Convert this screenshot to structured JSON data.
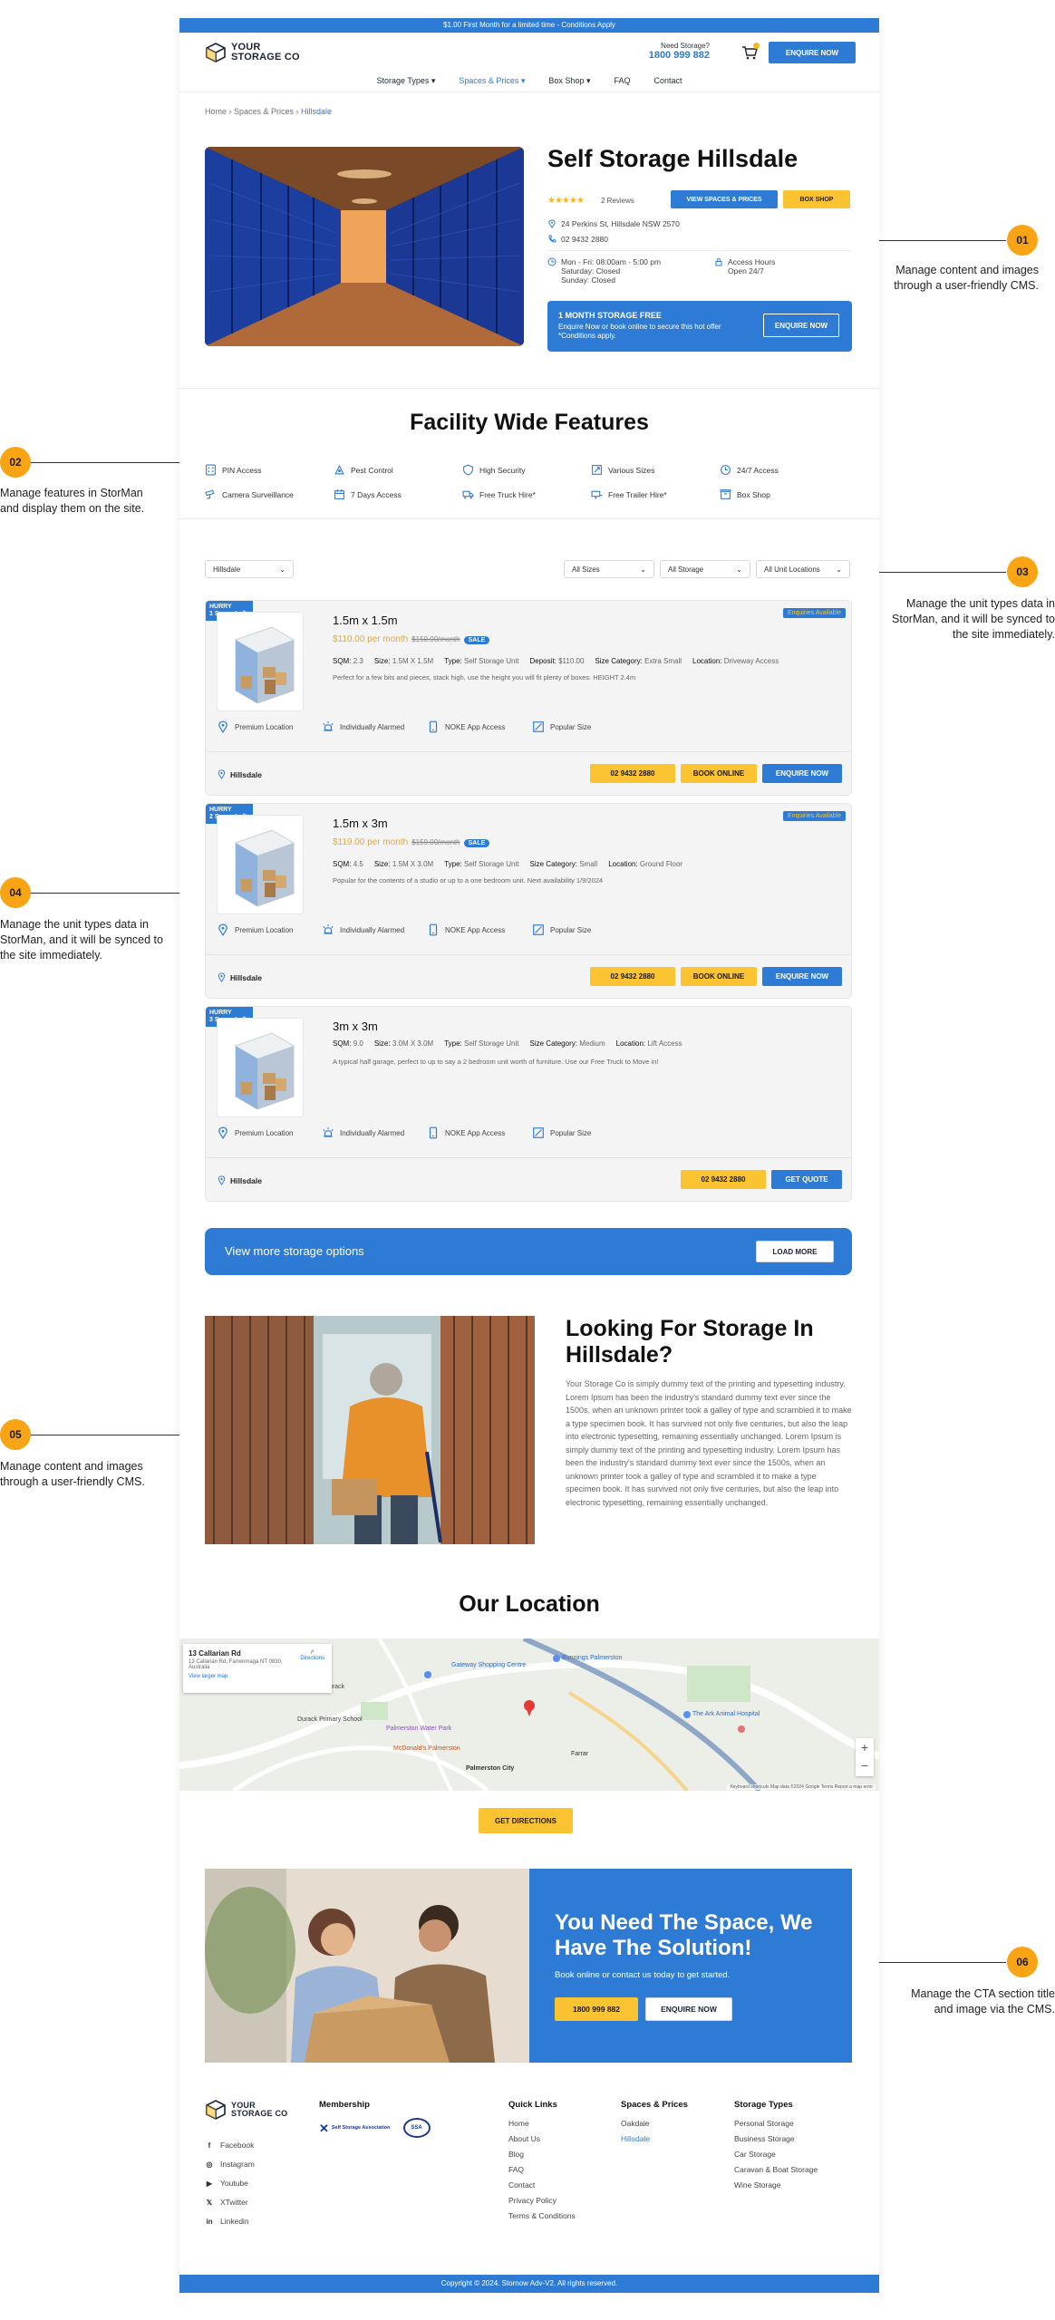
{
  "promo_bar": "$1.00 First Month for a limited time - Conditions Apply",
  "header": {
    "logo_line1": "YOUR",
    "logo_line2": "STORAGE CO",
    "need_storage": "Need Storage?",
    "phone": "1800 999 882",
    "enquire": "ENQUIRE NOW"
  },
  "nav": [
    "Storage Types",
    "Spaces & Prices",
    "Box Shop",
    "FAQ",
    "Contact"
  ],
  "breadcrumb": {
    "home": "Home",
    "spaces": "Spaces & Prices",
    "current": "Hillsdale"
  },
  "hero": {
    "title": "Self Storage Hillsdale",
    "reviews": "2 Reviews",
    "rating_stars": 5,
    "view_btn": "VIEW SPACES & PRICES",
    "box_btn": "BOX SHOP",
    "address": "24 Perkins St, Hillsdale NSW 2570",
    "phone": "02 9432 2880",
    "hours_line1": "Mon - Fri: 08:00am - 5:00 pm",
    "hours_line2": "Saturday: Closed",
    "hours_line3": "Sunday: Closed",
    "access_title": "Access Hours",
    "access_value": "Open 24/7",
    "offer_title": "1 MONTH STORAGE FREE",
    "offer_text": "Enquire Now or book online to secure this hot offer",
    "offer_note": "*Conditions apply.",
    "offer_btn": "ENQUIRE NOW"
  },
  "features": {
    "title": "Facility Wide Features",
    "items": [
      {
        "label": "PIN Access",
        "icon": "pin-pad-icon"
      },
      {
        "label": "Pest Control",
        "icon": "pest-control-icon"
      },
      {
        "label": "High Security",
        "icon": "shield-icon"
      },
      {
        "label": "Various Sizes",
        "icon": "sizes-icon"
      },
      {
        "label": "24/7 Access",
        "icon": "clock-icon"
      },
      {
        "label": "Camera Surveillance",
        "icon": "camera-icon"
      },
      {
        "label": "7 Days Access",
        "icon": "calendar-icon"
      },
      {
        "label": "Free Truck Hire*",
        "icon": "truck-icon"
      },
      {
        "label": "Free Trailer Hire*",
        "icon": "trailer-icon"
      },
      {
        "label": "Box Shop",
        "icon": "box-icon"
      }
    ]
  },
  "filters": {
    "location": "Hillsdale",
    "sizes": "All Sizes",
    "storage": "All Storage",
    "unit_locations": "All Unit Locations"
  },
  "units": [
    {
      "hurry_line1": "HURRY",
      "hurry_line2": "1 Space Left",
      "title": "1.5m x 1.5m",
      "price": "$110.00 per month",
      "old_price": "$150.00/month",
      "sale": "SALE",
      "enquiries": "Enquiries Available",
      "specs": [
        [
          "SQM:",
          "2.3"
        ],
        [
          "Size:",
          "1.5M X 1.5M"
        ],
        [
          "Type:",
          "Self Storage Unit"
        ],
        [
          "Deposit:",
          "$110.00"
        ],
        [
          "Size Category:",
          "Extra Small"
        ],
        [
          "Location:",
          "Driveway Access"
        ]
      ],
      "desc": "Perfect for a few bits and pieces, stack high, use the height you will fit plenty of boxes. HEIGHT 2.4m",
      "amenities": [
        "Premium Location",
        "Individually Alarmed",
        "NOKE App Access",
        "Popular Size"
      ],
      "location": "Hillsdale",
      "phone_btn": "02 9432 2880",
      "book_btn": "BOOK ONLINE",
      "enquire_btn": "ENQUIRE NOW"
    },
    {
      "hurry_line1": "HURRY",
      "hurry_line2": "2 Space Left",
      "title": "1.5m x 3m",
      "price": "$119.00 per month",
      "old_price": "$159.00/month",
      "sale": "SALE",
      "enquiries": "Enquiries Available",
      "specs": [
        [
          "SQM:",
          "4.5"
        ],
        [
          "Size:",
          "1.5M X 3.0M"
        ],
        [
          "Type:",
          "Self Storage Unit"
        ],
        [
          "Size Category:",
          "Small"
        ],
        [
          "Location:",
          "Ground Floor"
        ]
      ],
      "desc": "Popular for the contents of a studio or up to a one bedroom unit. Next availability 1/9/2024",
      "amenities": [
        "Premium Location",
        "Individually Alarmed",
        "NOKE App Access",
        "Popular Size"
      ],
      "location": "Hillsdale",
      "phone_btn": "02 9432 2880",
      "book_btn": "BOOK ONLINE",
      "enquire_btn": "ENQUIRE NOW"
    },
    {
      "hurry_line1": "HURRY",
      "hurry_line2": "3 Space Left",
      "title": "3m x 3m",
      "specs": [
        [
          "SQM:",
          "9.0"
        ],
        [
          "Size:",
          "3.0M X 3.0M"
        ],
        [
          "Type:",
          "Self Storage Unit"
        ],
        [
          "Size Category:",
          "Medium"
        ],
        [
          "Location:",
          "Lift Access"
        ]
      ],
      "desc": "A typical half garage, perfect to up to say a 2 bedroom unit worth of furniture. Use our Free Truck to Move in!",
      "amenities": [
        "Premium Location",
        "Individually Alarmed",
        "NOKE App Access",
        "Popular Size"
      ],
      "location": "Hillsdale",
      "phone_btn": "02 9432 2880",
      "quote_btn": "GET QUOTE"
    }
  ],
  "load_more": {
    "text": "View more storage options",
    "btn": "LOAD MORE"
  },
  "looking": {
    "title": "Looking For Storage In Hillsdale?",
    "body": "Your Storage Co is simply dummy text of the printing and typesetting industry. Lorem Ipsum has been the industry's standard dummy text ever since the 1500s, when an unknown printer took a galley of type and scrambled it to make a type specimen book. It has survived not only five centuries, but also the leap into electronic typesetting, remaining essentially unchanged. Lorem Ipsum is simply dummy text of the printing and typesetting industry. Lorem Ipsum has been the industry's standard dummy text ever since the 1500s, when an unknown printer took a galley of type and scrambled it to make a type specimen book. It has survived not only five centuries, but also the leap into electronic typesetting, remaining essentially unchanged."
  },
  "location": {
    "title": "Our Location",
    "card_title": "13 Callarian Rd",
    "card_address": "13 Callarian Rd, Farrenmaga NT 0830, Australia",
    "card_link": "View larger map",
    "directions_short": "Directions",
    "map_labels": [
      "Durack",
      "Palmerston Water Park",
      "McDonald's Palmerston",
      "Bunnings Palmerston",
      "The Ark Animal Hospital",
      "Palmerston City",
      "Farrar",
      "Gateway Shopping Centre",
      "Durack Primary School"
    ],
    "zoom_in": "+",
    "zoom_out": "−",
    "map_footer": "Keyboard shortcuts   Map data ©2024 Google   Terms   Report a map error",
    "directions_btn": "GET DIRECTIONS"
  },
  "cta": {
    "title": "You Need The Space, We Have The Solution!",
    "subtitle": "Book online or contact us today to get started.",
    "phone_btn": "1800 999 882",
    "enquire_btn": "ENQUIRE NOW"
  },
  "footer": {
    "membership_title": "Membership",
    "membership_1": "Self Storage Association",
    "membership_2": "SSA",
    "social": [
      "Facebook",
      "Instagram",
      "Youtube",
      "XTwitter",
      "Linkedin"
    ],
    "quick_title": "Quick Links",
    "quick": [
      "Home",
      "About Us",
      "Blog",
      "FAQ",
      "Contact",
      "Privacy Policy",
      "Terms & Conditions"
    ],
    "spaces_title": "Spaces & Prices",
    "spaces": [
      "Oakdale",
      "Hillsdale"
    ],
    "types_title": "Storage Types",
    "types": [
      "Personal Storage",
      "Business Storage",
      "Car Storage",
      "Caravan & Boat Storage",
      "Wine Storage"
    ],
    "copyright": "Copyright © 2024. Stornow Adv-V2. All rights reserved."
  },
  "annotations": [
    {
      "num": "01",
      "text": "Manage content and images through a user-friendly CMS."
    },
    {
      "num": "02",
      "text": "Manage features in StorMan and display them on the site."
    },
    {
      "num": "03",
      "text": "Manage the unit types data in StorMan, and it will be synced to the site immediately."
    },
    {
      "num": "04",
      "text": "Manage the unit types data in StorMan, and it will be synced to the site immediately."
    },
    {
      "num": "05",
      "text": "Manage content and images through a user-friendly CMS."
    },
    {
      "num": "06",
      "text": "Manage the CTA section title and image via the CMS."
    }
  ],
  "colors": {
    "brand_blue": "#2e7bd6",
    "accent_yellow": "#f9c332",
    "price_orange": "#f5a623",
    "marker_orange": "#f8a414"
  }
}
